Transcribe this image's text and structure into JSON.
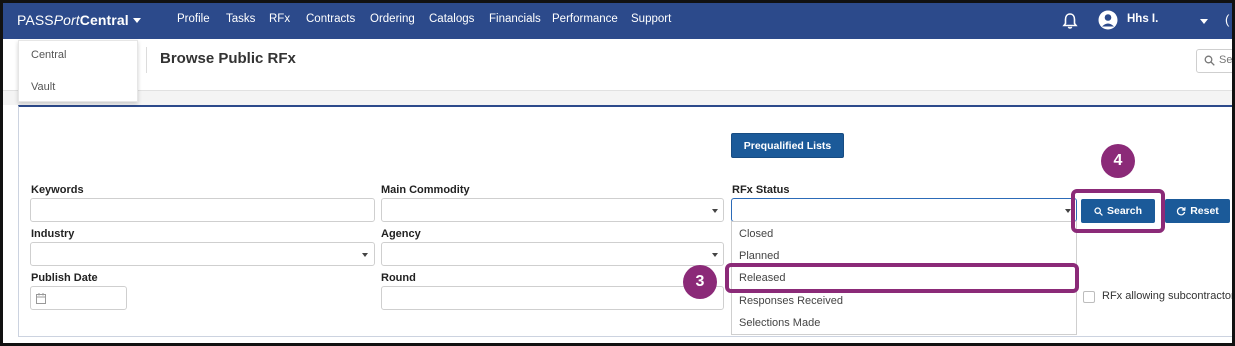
{
  "nav": {
    "brand_part1": "PASS",
    "brand_part2": "Port",
    "brand_part3": "Central",
    "items": [
      {
        "label": "Profile"
      },
      {
        "label": "Tasks"
      },
      {
        "label": "RFx"
      },
      {
        "label": "Contracts"
      },
      {
        "label": "Ordering"
      },
      {
        "label": "Catalogs"
      },
      {
        "label": "Financials"
      },
      {
        "label": "Performance"
      },
      {
        "label": "Support"
      }
    ],
    "user_name": "Hhs I.",
    "extra": "("
  },
  "brand_menu": {
    "items": [
      {
        "label": "Central"
      },
      {
        "label": "Vault"
      }
    ]
  },
  "page": {
    "title": "Browse Public RFx",
    "search_placeholder": "Se"
  },
  "form": {
    "prequalified_button": "Prequalified Lists",
    "keywords_label": "Keywords",
    "main_commodity_label": "Main Commodity",
    "rfx_status_label": "RFx Status",
    "industry_label": "Industry",
    "agency_label": "Agency",
    "publish_date_label": "Publish Date",
    "round_label": "Round",
    "search_button": "Search",
    "reset_button": "Reset",
    "subcontractors_label": "RFx allowing subcontractors",
    "status_options": [
      {
        "label": "Closed"
      },
      {
        "label": "Planned"
      },
      {
        "label": "Released"
      },
      {
        "label": "Responses Received"
      },
      {
        "label": "Selections Made"
      }
    ]
  },
  "callouts": {
    "step3": "3",
    "step4": "4"
  },
  "colors": {
    "nav_bg": "#2c4a8b",
    "button_bg": "#1b5a99",
    "callout": "#8b2a78"
  }
}
